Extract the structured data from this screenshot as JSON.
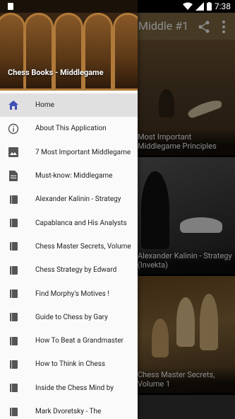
{
  "status_bar": {
    "time": "7:38"
  },
  "toolbar": {
    "title": "Middle #1"
  },
  "cards": [
    {
      "caption": "Most Important Middlegame Principles"
    },
    {
      "caption": "Alexander Kalinin - Strategy (Invekta)"
    },
    {
      "caption": "Chess Master Secrets, Volume 1"
    }
  ],
  "drawer": {
    "header_title": "Chess Books - Middlegame",
    "items": [
      {
        "label": "Home",
        "icon": "home-icon"
      },
      {
        "label": "About This Application",
        "icon": "info-icon"
      },
      {
        "label": "7 Most Important Middlegame",
        "icon": "image-icon"
      },
      {
        "label": "Must-know: Middlegame",
        "icon": "document-icon"
      },
      {
        "label": "Alexander Kalinin - Strategy",
        "icon": "book-icon"
      },
      {
        "label": "Capablanca and His Analysts",
        "icon": "book-icon"
      },
      {
        "label": "Chess Master Secrets, Volume",
        "icon": "book-icon"
      },
      {
        "label": "Chess Strategy by Edward",
        "icon": "book-icon"
      },
      {
        "label": "Find Morphy's Motives !",
        "icon": "book-icon"
      },
      {
        "label": "Guide to Chess by Gary",
        "icon": "book-icon"
      },
      {
        "label": "How To Beat a Grandmaster",
        "icon": "book-icon"
      },
      {
        "label": "How to Think in Chess",
        "icon": "book-icon"
      },
      {
        "label": "Inside the Chess Mind by",
        "icon": "book-icon"
      },
      {
        "label": "Mark Dvoretsky - The",
        "icon": "book-icon"
      }
    ]
  },
  "colors": {
    "accent": "#3f51b5",
    "toolbar": "#806a44"
  }
}
